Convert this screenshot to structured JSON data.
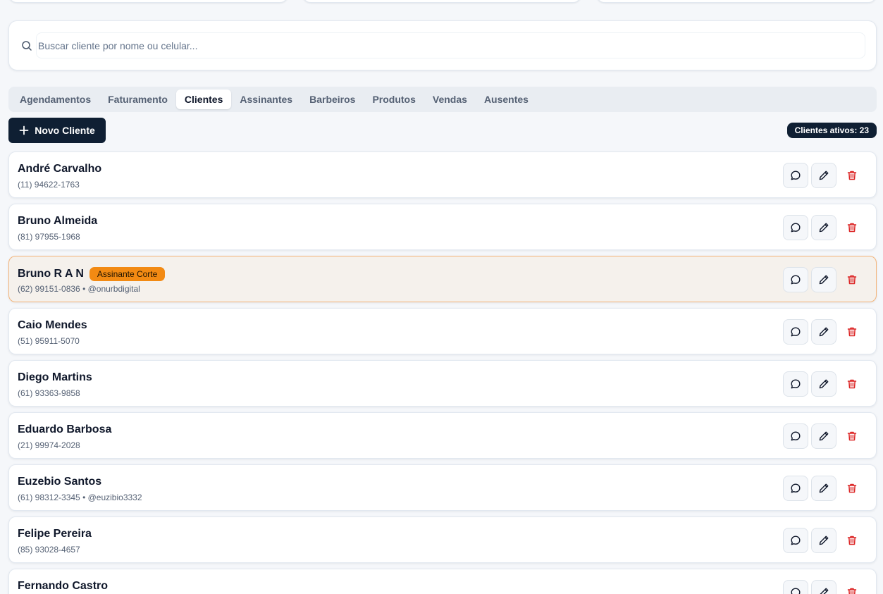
{
  "search": {
    "placeholder": "Buscar cliente por nome ou celular..."
  },
  "tabs": [
    {
      "label": "Agendamentos",
      "active": false
    },
    {
      "label": "Faturamento",
      "active": false
    },
    {
      "label": "Clientes",
      "active": true
    },
    {
      "label": "Assinantes",
      "active": false
    },
    {
      "label": "Barbeiros",
      "active": false
    },
    {
      "label": "Produtos",
      "active": false
    },
    {
      "label": "Vendas",
      "active": false
    },
    {
      "label": "Ausentes",
      "active": false
    }
  ],
  "toolbar": {
    "new_client_label": "Novo Cliente",
    "active_clients_label": "Clientes ativos: 23"
  },
  "colors": {
    "primary": "#0f1f33",
    "subscriber_badge": "#f28a13",
    "delete": "#dc2626",
    "highlight_bg": "#f5f1ec"
  },
  "clients": [
    {
      "name": "André Carvalho",
      "meta": "(11) 94622-1763",
      "badge": ""
    },
    {
      "name": "Bruno Almeida",
      "meta": "(81) 97955-1968",
      "badge": ""
    },
    {
      "name": "Bruno R A N",
      "meta": "(62) 99151-0836 • @onurbdigital",
      "badge": "Assinante Corte"
    },
    {
      "name": "Caio Mendes",
      "meta": "(51) 95911-5070",
      "badge": ""
    },
    {
      "name": "Diego Martins",
      "meta": "(61) 93363-9858",
      "badge": ""
    },
    {
      "name": "Eduardo Barbosa",
      "meta": "(21) 99974-2028",
      "badge": ""
    },
    {
      "name": "Euzebio Santos",
      "meta": "(61) 98312-3345 • @euzibio3332",
      "badge": ""
    },
    {
      "name": "Felipe Pereira",
      "meta": "(85) 93028-4657",
      "badge": ""
    },
    {
      "name": "Fernando Castro",
      "meta": "",
      "badge": ""
    }
  ]
}
